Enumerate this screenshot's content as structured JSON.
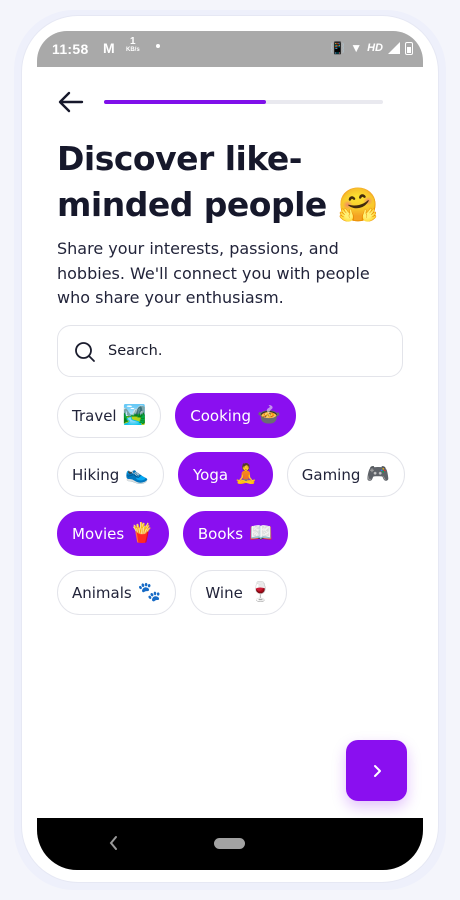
{
  "status_bar": {
    "time": "11:58",
    "mail_glyph": "M",
    "speed_value": "1",
    "speed_unit": "KB/s",
    "network": "HD"
  },
  "header": {
    "progress_fraction": 0.58,
    "progress_color": "#7f10ea"
  },
  "title": "Discover like-minded people 🤗",
  "subtitle": "Share your interests, passions, and hobbies. We'll connect you with people who share your enthusiasm.",
  "search": {
    "placeholder": "Search."
  },
  "accent_color": "#8a0ff0",
  "interests": [
    {
      "label": "Travel",
      "emoji": "🏞️",
      "selected": false
    },
    {
      "label": "Cooking",
      "emoji": "🍲",
      "selected": true
    },
    {
      "label": "Hiking",
      "emoji": "👟",
      "selected": false
    },
    {
      "label": "Yoga",
      "emoji": "🧘",
      "selected": true
    },
    {
      "label": "Gaming",
      "emoji": "🎮",
      "selected": false
    },
    {
      "label": "Movies",
      "emoji": "🍟",
      "selected": true
    },
    {
      "label": "Books",
      "emoji": "📖",
      "selected": true
    },
    {
      "label": "Animals",
      "emoji": "🐾",
      "selected": false
    },
    {
      "label": "Wine",
      "emoji": "🍷",
      "selected": false
    }
  ],
  "icons": {
    "back": "arrow-left-icon",
    "search": "search-icon",
    "next": "chevron-right-icon"
  }
}
